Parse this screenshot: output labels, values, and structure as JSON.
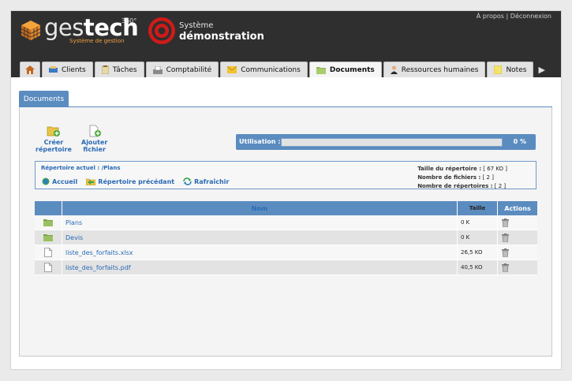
{
  "header": {
    "brand_light": "ges",
    "brand_bold": "tech",
    "brand_sup": "360°",
    "brand_sub": "Système de gestion",
    "client_line1": "Système",
    "client_line2": "démonstration",
    "link_about": "À propos",
    "link_sep": "|",
    "link_logout": "Déconnexion",
    "accent": "#d01a1a"
  },
  "tabs": [
    {
      "label": "",
      "icon": "home-icon"
    },
    {
      "label": "Clients",
      "icon": "clients-icon"
    },
    {
      "label": "Tâches",
      "icon": "tasks-icon"
    },
    {
      "label": "Comptabilité",
      "icon": "accounting-icon"
    },
    {
      "label": "Communications",
      "icon": "mail-icon"
    },
    {
      "label": "Documents",
      "icon": "folder-icon",
      "active": true
    },
    {
      "label": "Ressources humaines",
      "icon": "person-icon"
    },
    {
      "label": "Notes",
      "icon": "note-icon"
    }
  ],
  "subtab": {
    "label": "Documents"
  },
  "toolbar": {
    "create_dir_line1": "Créer",
    "create_dir_line2": "répertoire",
    "add_file_line1": "Ajouter",
    "add_file_line2": "fichier"
  },
  "usage": {
    "label": "Utilisation :",
    "value_text": "0 %",
    "fraction": 0.0
  },
  "directory": {
    "current": "Répertoire actuel : /Plans",
    "actions": {
      "home": "Accueil",
      "previous": "Répertoire précédant",
      "refresh": "Rafraîchir"
    },
    "stats": {
      "size_label": "Taille du répertoire :",
      "size_value": "[ 67 KO ]",
      "files_label": "Nombre de fichiers :",
      "files_value": "[ 2 ]",
      "dirs_label": "Nombre de répertoires :",
      "dirs_value": "[ 2 ]"
    }
  },
  "table": {
    "headers": {
      "name": "Nom",
      "size": "Taille",
      "actions": "Actions"
    },
    "rows": [
      {
        "type": "folder",
        "name": "Plans",
        "size": "0 K"
      },
      {
        "type": "folder",
        "name": "Devis",
        "size": "0 K"
      },
      {
        "type": "file",
        "name": "liste_des_forfaits.xlsx",
        "size": "26,5 KO"
      },
      {
        "type": "file",
        "name": "liste_des_forfaits.pdf",
        "size": "40,5 KO"
      }
    ]
  },
  "colors": {
    "blue": "#5b8cc0",
    "link": "#2a6ab5",
    "header_bg": "#2f2f2f"
  }
}
